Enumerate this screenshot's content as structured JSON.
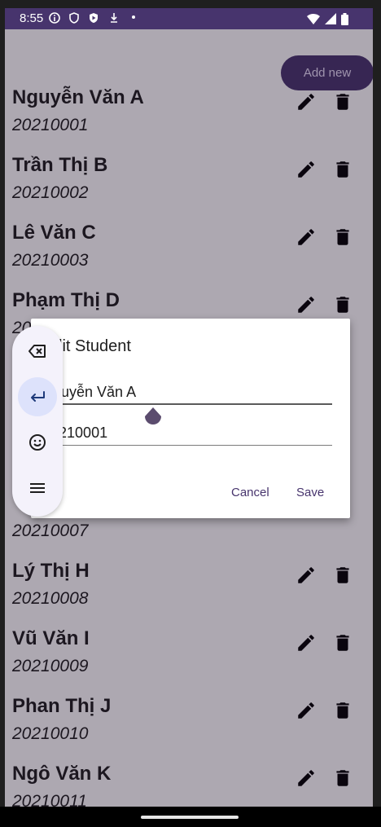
{
  "status_bar": {
    "time": "8:55"
  },
  "header": {
    "add_new_label": "Add new"
  },
  "students": [
    {
      "name": "Nguyễn Văn A",
      "code": "20210001"
    },
    {
      "name": "Trần Thị B",
      "code": "20210002"
    },
    {
      "name": "Lê Văn C",
      "code": "20210003"
    },
    {
      "name": "Phạm Thị D",
      "code": "20210004"
    },
    {
      "name": "",
      "code": "20210007"
    },
    {
      "name": "Lý Thị H",
      "code": "20210008"
    },
    {
      "name": "Vũ Văn I",
      "code": "20210009"
    },
    {
      "name": "Phan Thị J",
      "code": "20210010"
    },
    {
      "name": "Ngô Văn K",
      "code": "20210011"
    }
  ],
  "dialog": {
    "title": "Edit Student",
    "name_value": "Nguyễn Văn A",
    "code_value": "20210001",
    "cancel_label": "Cancel",
    "save_label": "Save"
  },
  "keyboard_toolbar": {
    "icons": [
      "backspace-icon",
      "enter-icon",
      "emoji-icon",
      "menu-icon"
    ]
  },
  "colors": {
    "status_bar": "#47346d",
    "accent": "#47346d",
    "scrim": "#1c0e28",
    "toolbar_bg": "#f4f2fb",
    "enter_highlight": "#dde2fb"
  }
}
